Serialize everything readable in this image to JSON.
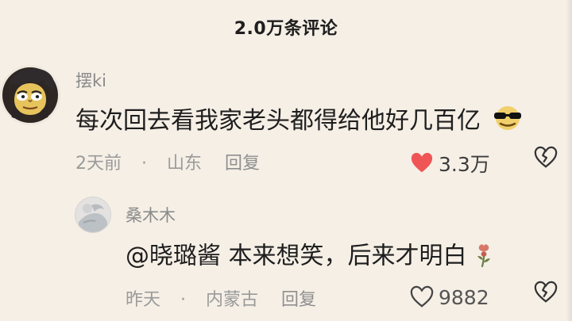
{
  "header": {
    "title": "2.0万条评论"
  },
  "comments": [
    {
      "username": "摆ki",
      "content": "每次回去看我家老头都得给他好几百亿",
      "time": "2天前",
      "dot": "·",
      "location": "山东",
      "reply_label": "回复",
      "likes": "3.3万"
    }
  ],
  "reply": {
    "username": "桑木木",
    "content": "@晓璐酱 本来想笑，后来才明白",
    "time": "昨天",
    "dot": "·",
    "location": "内蒙古",
    "reply_label": "回复",
    "likes": "9882"
  },
  "icons": {
    "main_avatar": "cartoon-avatar",
    "small_avatar": "photo-avatar",
    "sunglasses": "sunglasses-emoji-icon",
    "filled_heart": "heart-filled-icon",
    "outline_heart": "heart-outline-icon",
    "broken_heart": "broken-heart-icon",
    "rose": "wilted-rose-emoji-icon"
  },
  "colors": {
    "background": "#f5efe6",
    "accent_red": "#f05555",
    "text_primary": "#1f1f1f",
    "text_secondary": "#9a9a9a"
  }
}
